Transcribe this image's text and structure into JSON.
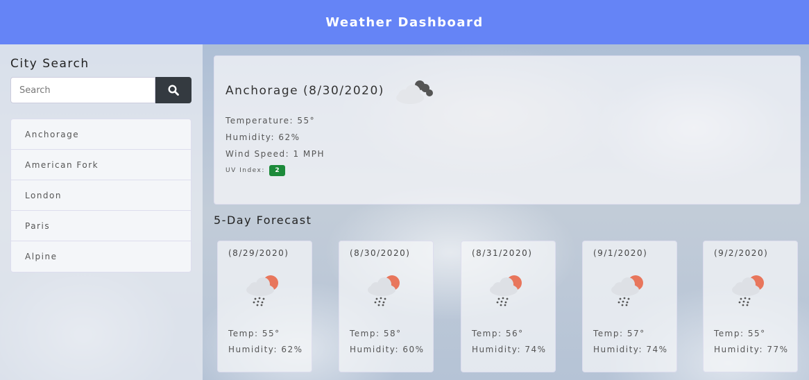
{
  "header": {
    "title": "Weather Dashboard"
  },
  "sidebar": {
    "title": "City Search",
    "search": {
      "placeholder": "Search",
      "value": ""
    },
    "search_button_icon": "search-icon",
    "cities": [
      "Anchorage",
      "American Fork",
      "London",
      "Paris",
      "Alpine"
    ]
  },
  "current": {
    "title": "Anchorage (8/30/2020)",
    "icon": "cloudy-night-icon",
    "temperature": "Temperature: 55°",
    "humidity": "Humidity: 62%",
    "wind": "Wind Speed: 1 MPH",
    "uv_label": "UV Index:",
    "uv_value": "2",
    "uv_color": "#1c8a3a"
  },
  "forecast": {
    "title": "5-Day Forecast",
    "days": [
      {
        "date": "(8/29/2020)",
        "icon": "rain-sun-icon",
        "temp": "Temp: 55°",
        "humidity": "Humidity: 62%"
      },
      {
        "date": "(8/30/2020)",
        "icon": "rain-sun-icon",
        "temp": "Temp: 58°",
        "humidity": "Humidity: 60%"
      },
      {
        "date": "(8/31/2020)",
        "icon": "rain-sun-icon",
        "temp": "Temp: 56°",
        "humidity": "Humidity: 74%"
      },
      {
        "date": "(9/1/2020)",
        "icon": "rain-sun-icon",
        "temp": "Temp: 57°",
        "humidity": "Humidity: 74%"
      },
      {
        "date": "(9/2/2020)",
        "icon": "rain-sun-icon",
        "temp": "Temp: 55°",
        "humidity": "Humidity: 77%"
      }
    ]
  },
  "colors": {
    "header": "#6584f6",
    "search_button": "#343a40",
    "sun": "#e8765c"
  }
}
